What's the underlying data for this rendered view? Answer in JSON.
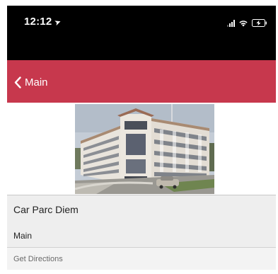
{
  "status_bar": {
    "time": "12:12",
    "location_icon": "location-arrow-icon",
    "signal_icon": "cellular-signal-icon",
    "wifi_icon": "wifi-icon",
    "battery_icon": "battery-charging-icon"
  },
  "nav": {
    "back_label": "Main",
    "back_icon": "chevron-left-icon",
    "bar_color": "#c7384d"
  },
  "photo": {
    "subject": "parking-garage-photo"
  },
  "info": {
    "title": "Car Parc Diem",
    "subtitle": "Main",
    "directions_label": "Get Directions"
  }
}
